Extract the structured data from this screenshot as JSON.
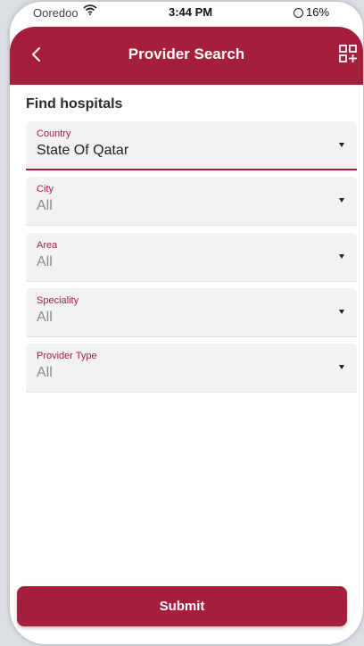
{
  "status_bar": {
    "carrier": "Ooredoo",
    "time": "3:44 PM",
    "battery": "16%"
  },
  "header": {
    "title": "Provider Search",
    "back_icon": "chevron-left-icon",
    "action_icon": "qr-code-icon"
  },
  "section_title": "Find hospitals",
  "fields": [
    {
      "label": "Country",
      "value": "State Of Qatar"
    },
    {
      "label": "City",
      "value": "All"
    },
    {
      "label": "Area",
      "value": "All"
    },
    {
      "label": "Speciality",
      "value": "All"
    },
    {
      "label": "Provider Type",
      "value": "All"
    }
  ],
  "submit_label": "Submit",
  "colors": {
    "brand": "#a51f3c",
    "field_background": "#f4f1f3"
  }
}
